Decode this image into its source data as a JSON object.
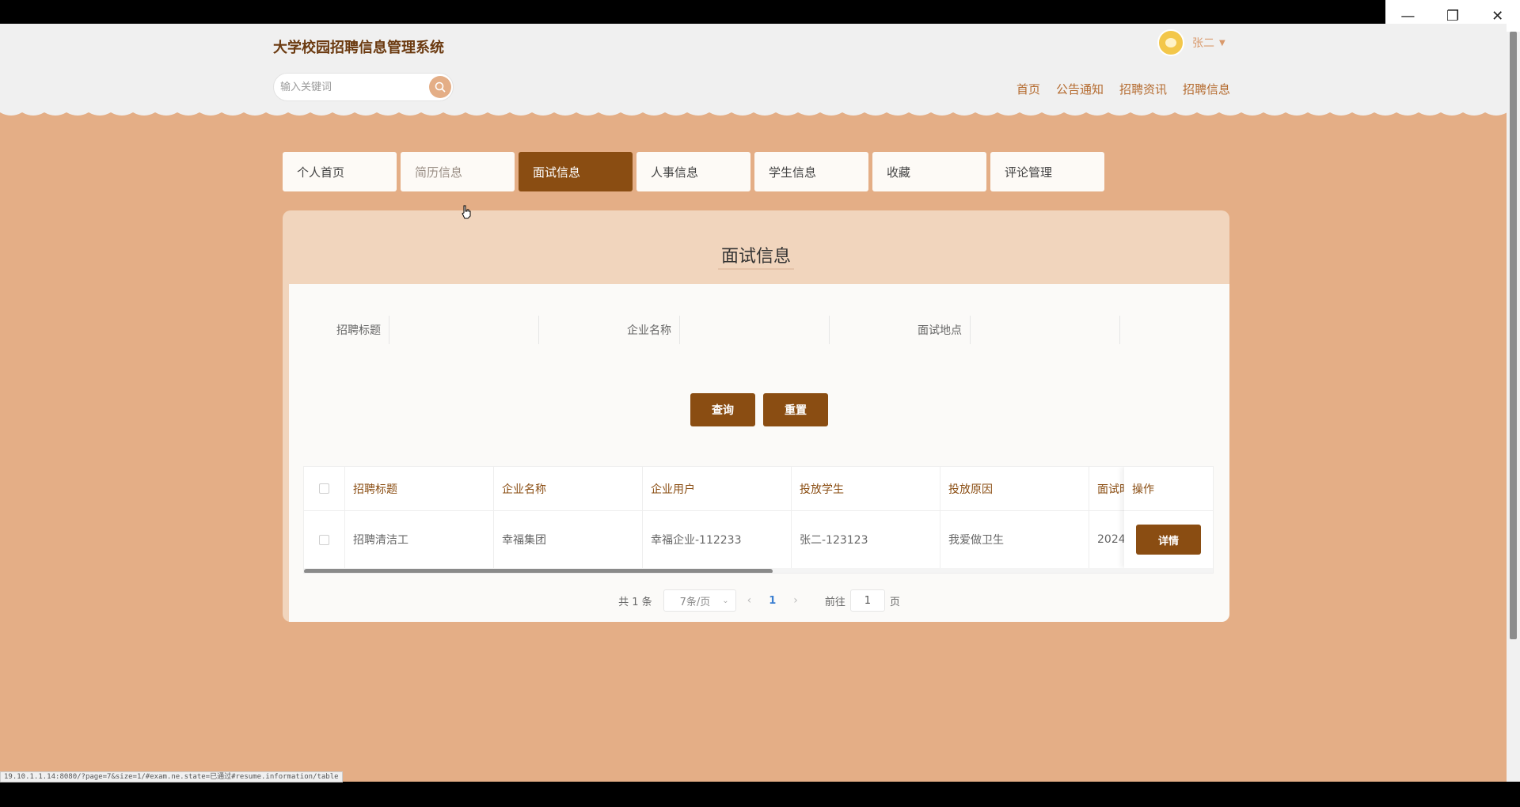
{
  "window": {
    "minimize_icon": "minimize-icon",
    "restore_icon": "restore-icon",
    "close_icon": "close-icon"
  },
  "header": {
    "site_title": "大学校园招聘信息管理系统",
    "search_placeholder": "输入关键词",
    "username": "张二",
    "nav": [
      "首页",
      "公告通知",
      "招聘资讯",
      "招聘信息"
    ]
  },
  "tabs": [
    {
      "label": "个人首页"
    },
    {
      "label": "简历信息"
    },
    {
      "label": "面试信息"
    },
    {
      "label": "人事信息"
    },
    {
      "label": "学生信息"
    },
    {
      "label": "收藏"
    },
    {
      "label": "评论管理"
    }
  ],
  "panel": {
    "title": "面试信息",
    "filters": [
      {
        "label": "招聘标题",
        "value": ""
      },
      {
        "label": "企业名称",
        "value": ""
      },
      {
        "label": "面试地点",
        "value": ""
      }
    ],
    "query_button": "查询",
    "reset_button": "重置"
  },
  "table": {
    "columns": [
      "招聘标题",
      "企业名称",
      "企业用户",
      "投放学生",
      "投放原因",
      "面试时",
      "操作"
    ],
    "rows": [
      {
        "cells": [
          "招聘清洁工",
          "幸福集团",
          "幸福企业-112233",
          "张二-123123",
          "我爱做卫生",
          "2024-"
        ],
        "action": "详情"
      }
    ]
  },
  "pagination": {
    "total": "共 1 条",
    "page_size": "7条/页",
    "current_page": "1",
    "goto_label": "前往",
    "goto_value": "1",
    "page_suffix": "页"
  },
  "status_url": "19.10.1.1.14:8080/?page=7&size=1/#exam.ne.state=已通过#resume.information/table",
  "colors": {
    "accent": "#8a4d12",
    "background": "#e4ae86",
    "panel_header": "#f1d5bd"
  }
}
